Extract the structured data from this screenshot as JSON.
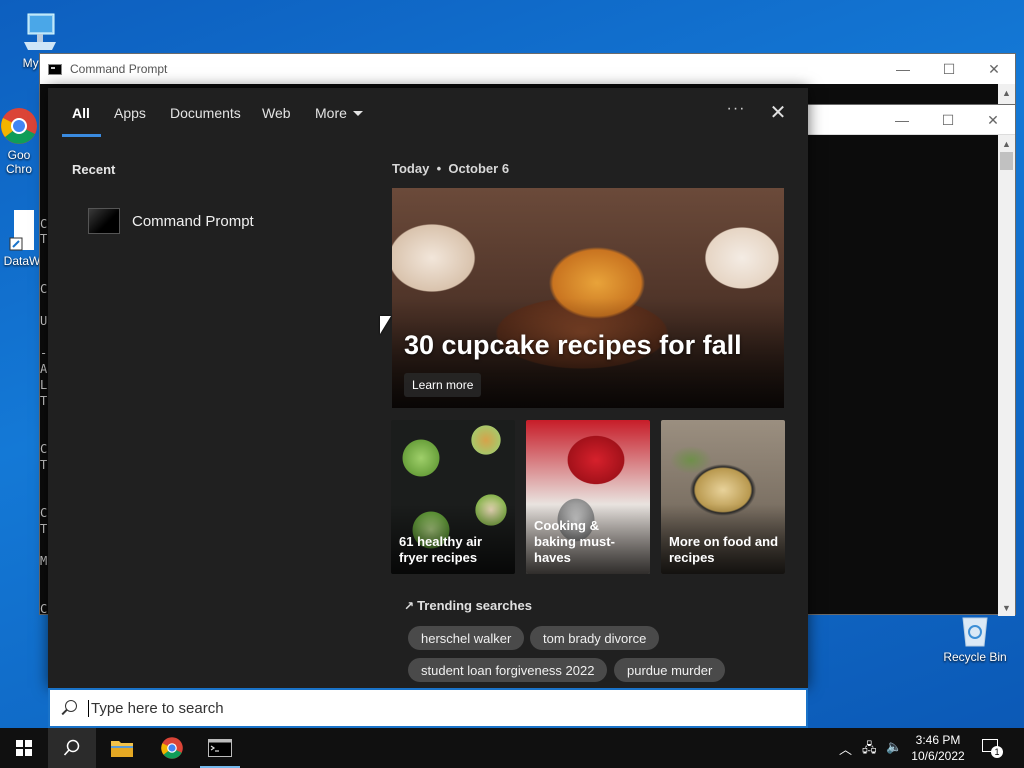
{
  "desktop": {
    "icons": [
      {
        "label": "My Co"
      },
      {
        "label": "Goo Chro"
      },
      {
        "label": "DataW"
      },
      {
        "label": "Recycle Bin"
      }
    ]
  },
  "windows": {
    "cmd_title": "Command Prompt",
    "console_edge": [
      "C",
      "T",
      "C",
      "U",
      "-",
      "A",
      "L",
      "T",
      "C",
      "T",
      "C",
      "T",
      "M",
      "C"
    ]
  },
  "search": {
    "tabs": [
      {
        "label": "All",
        "active": true
      },
      {
        "label": "Apps"
      },
      {
        "label": "Documents"
      },
      {
        "label": "Web"
      },
      {
        "label": "More"
      }
    ],
    "ellipsis": "···",
    "close": "✕",
    "recent_title": "Recent",
    "recent_items": [
      {
        "label": "Command Prompt"
      }
    ],
    "today": "Today",
    "date": "October 6",
    "hero": {
      "title": "30 cupcake recipes for fall",
      "button": "Learn more"
    },
    "cards": [
      {
        "label": "61 healthy air fryer recipes"
      },
      {
        "label": "Cooking & baking must-haves"
      },
      {
        "label": "More on food and recipes"
      }
    ],
    "trending_title": "Trending searches",
    "trending": [
      "herschel walker",
      "tom brady divorce",
      "student loan forgiveness 2022",
      "purdue murder"
    ],
    "placeholder": "Type here to search"
  },
  "taskbar": {
    "time": "3:46 PM",
    "date": "10/6/2022",
    "notification_count": "1"
  },
  "colors": {
    "accent": "#3a8be0",
    "panel_bg": "#202020",
    "taskbar_bg": "#101010"
  }
}
